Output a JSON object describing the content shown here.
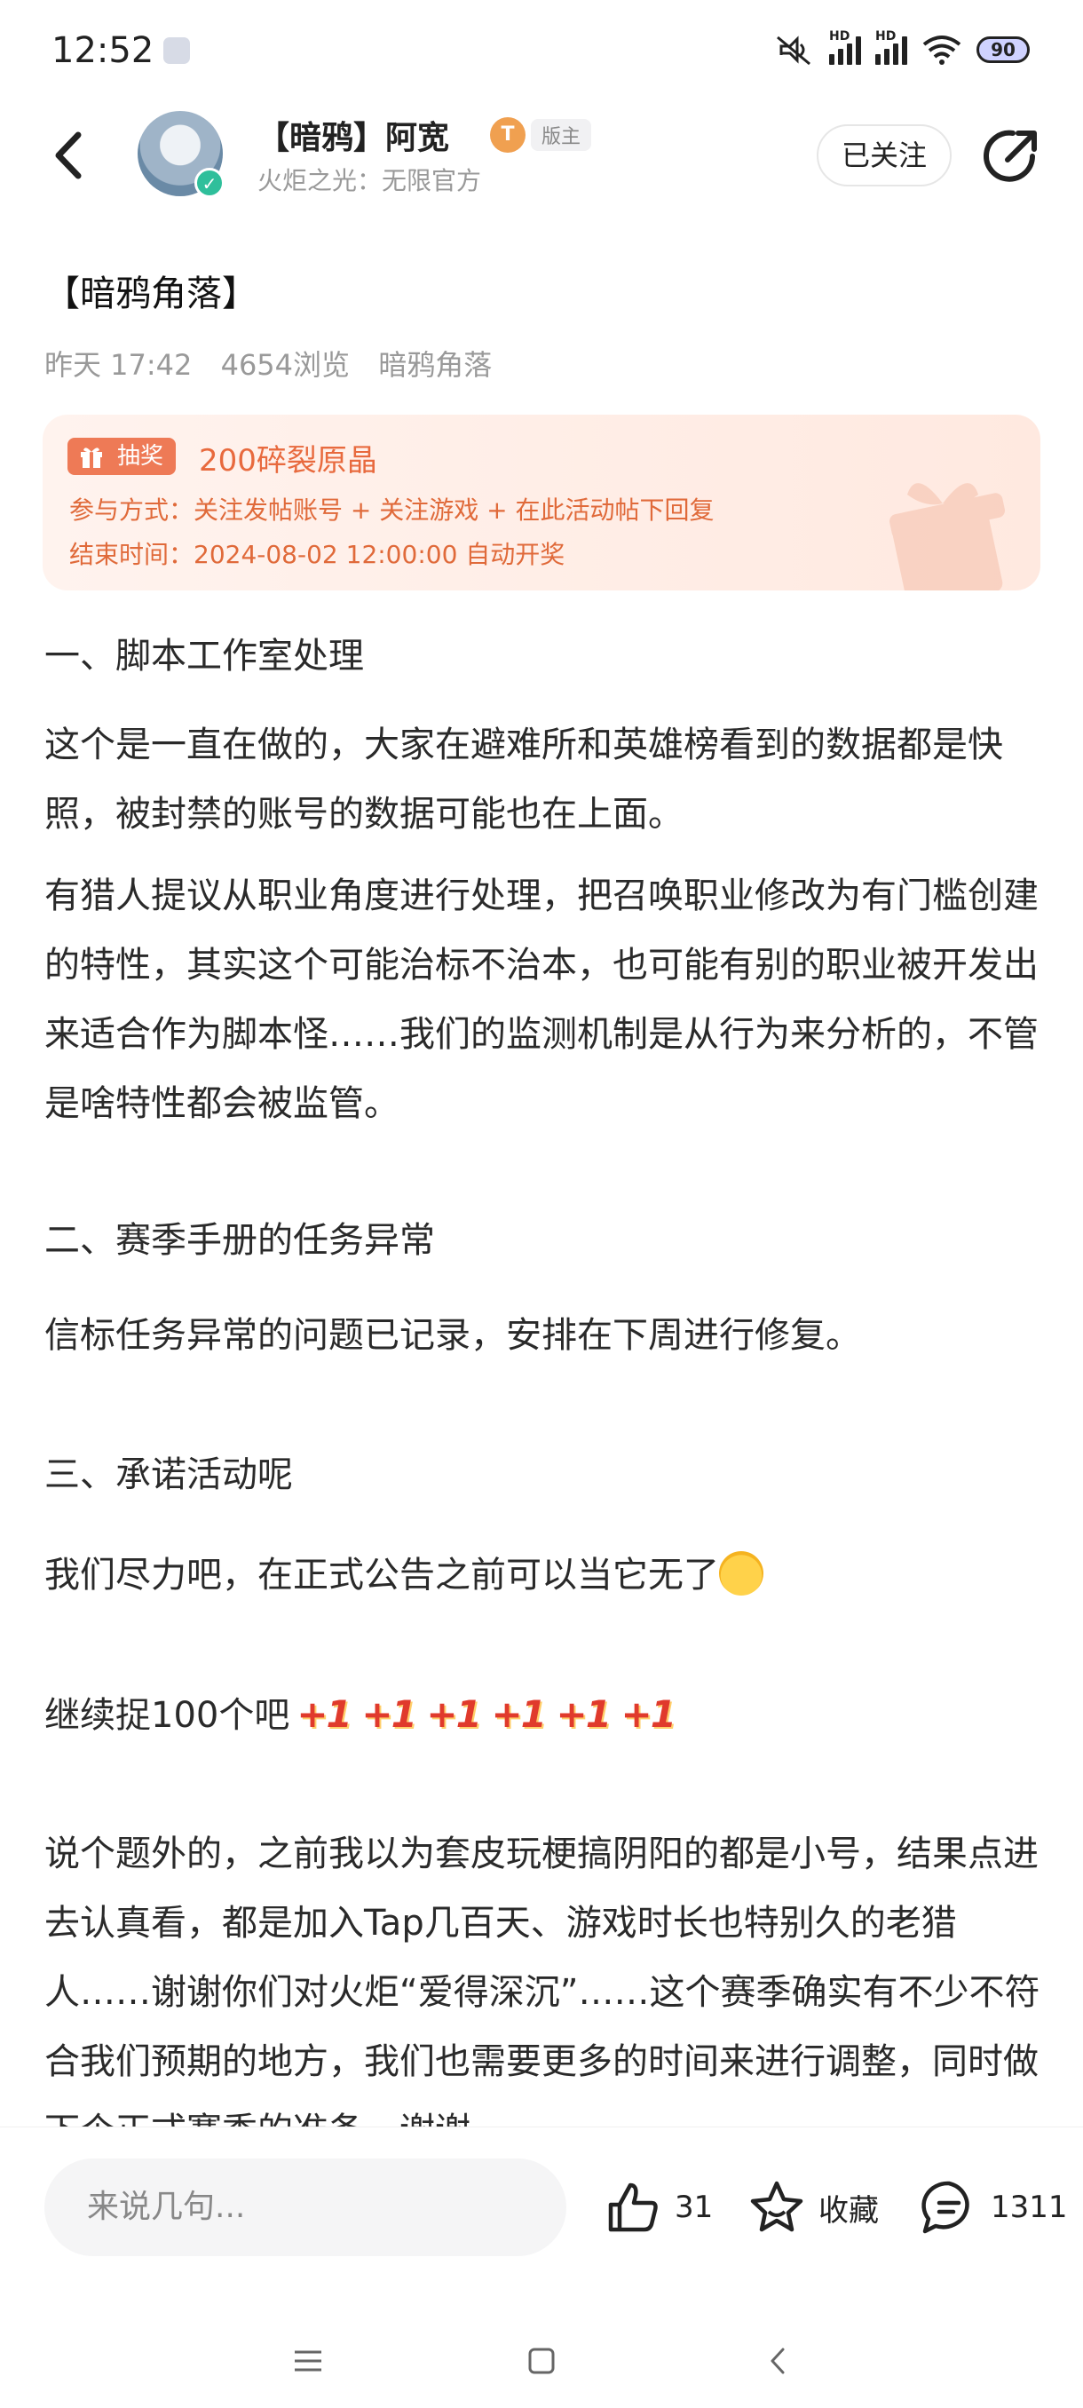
{
  "status_bar": {
    "time": "12:52",
    "battery": "90",
    "hd1": "HD",
    "hd2": "HD"
  },
  "header": {
    "username": "【暗鸦】阿宽",
    "level_badge": "T",
    "moderator_tag": "版主",
    "subtitle": "火炬之光：无限官方",
    "follow_label": "已关注"
  },
  "post": {
    "title": "【暗鸦角落】",
    "date": "昨天 17:42",
    "views": "4654浏览",
    "board": "暗鸦角落"
  },
  "lottery": {
    "tag": "抽奖",
    "prize": "200碎裂原晶",
    "participation": "参与方式：关注发帖账号 + 关注游戏 + 在此活动帖下回复",
    "end_time": "结束时间：2024-08-02 12:00:00 自动开奖"
  },
  "body": {
    "h1": "一、脚本工作室处理",
    "p1": "这个是一直在做的，大家在避难所和英雄榜看到的数据都是快照，被封禁的账号的数据可能也在上面。",
    "p2": "有猎人提议从职业角度进行处理，把召唤职业修改为有门槛创建的特性，其实这个可能治标不治本，也可能有别的职业被开发出来适合作为脚本怪……我们的监测机制是从行为来分析的，不管是啥特性都会被监管。",
    "h2": "二、赛季手册的任务异常",
    "p3": "信标任务异常的问题已记录，安排在下周进行修复。",
    "h3": "三、承诺活动呢",
    "p4": "我们尽力吧，在正式公告之前可以当它无了",
    "p5": "继续捉100个吧",
    "p5_stickers": "+1 +1 +1 +1 +1 +1",
    "p6": "说个题外的，之前我以为套皮玩梗搞阴阳的都是小号，结果点进去认真看，都是加入Tap几百天、游戏时长也特别久的老猎人……谢谢你们对火炬“爱得深沉”……这个赛季确实有不少不符合我们预期的地方，我们也需要更多的时间来进行调整，同时做下个正式赛季的准备，谢谢"
  },
  "bottom": {
    "comment_placeholder": "来说几句...",
    "likes": "31",
    "favorite_label": "收藏",
    "comments": "1311"
  }
}
